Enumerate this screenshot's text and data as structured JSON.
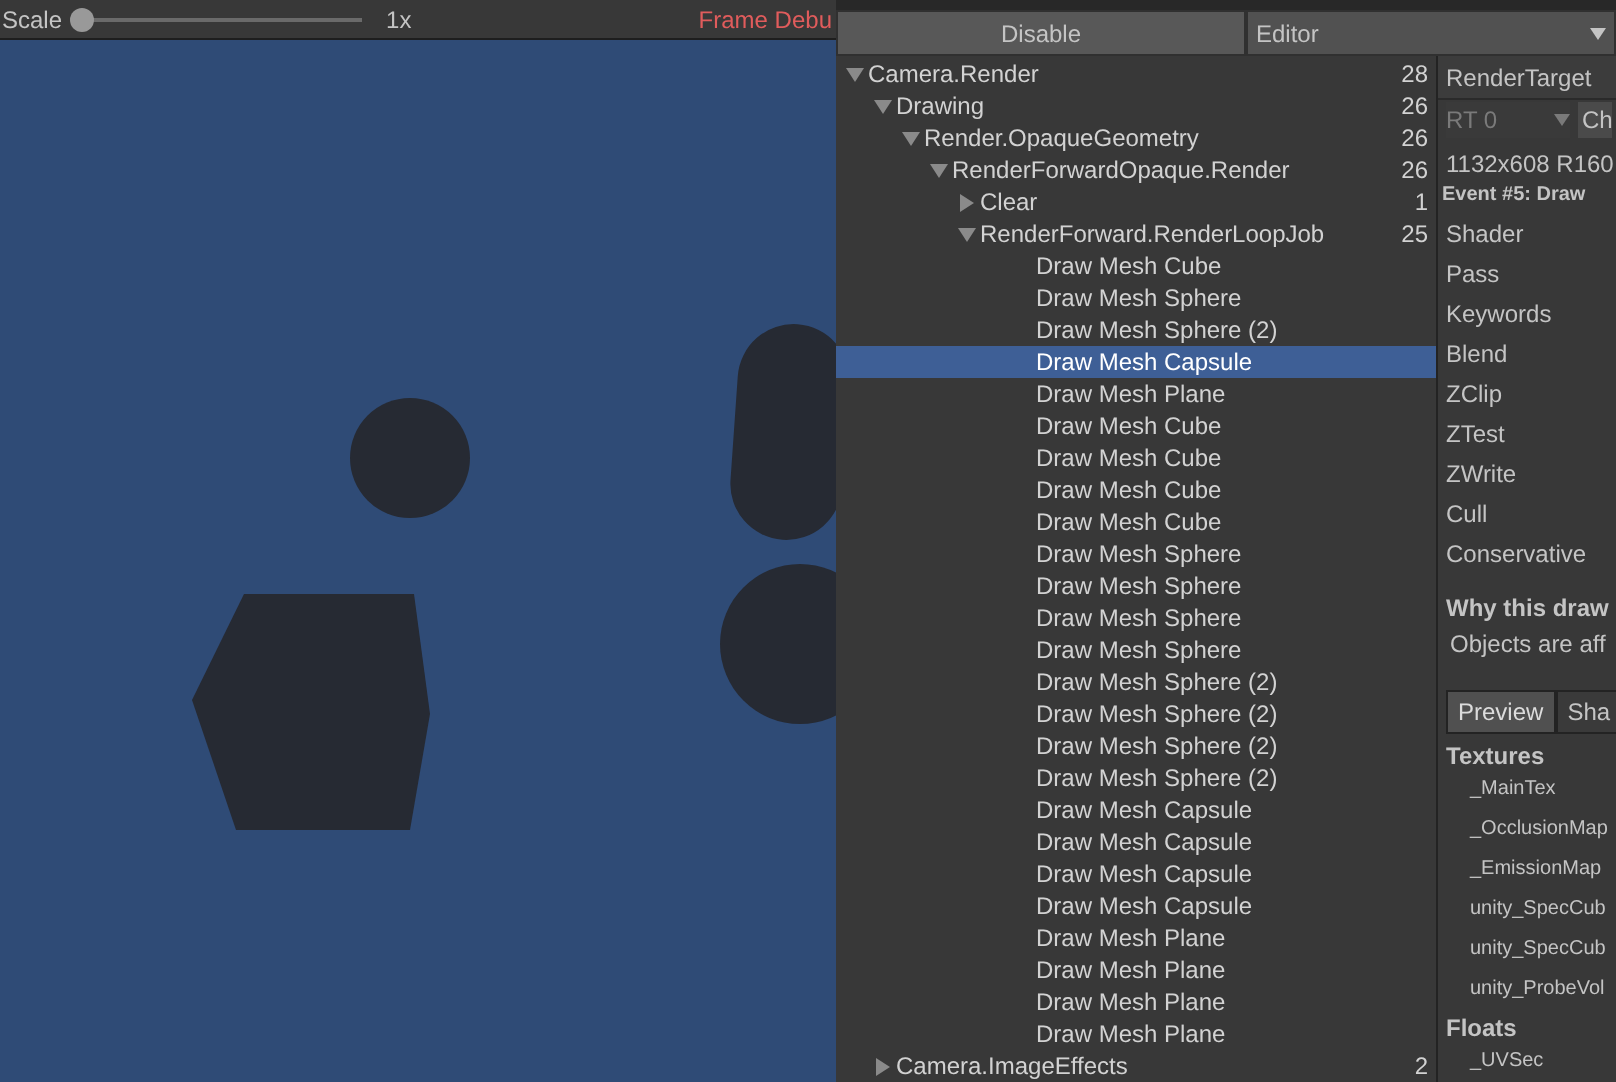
{
  "game_view": {
    "scale_label": "Scale",
    "scale_slider": {
      "level": 0
    },
    "scale_value": "1x",
    "frame_debugger_label": "Frame Debu"
  },
  "toolbar": {
    "disable_button": "Disable",
    "target_dropdown": "Editor"
  },
  "event_tree": [
    {
      "label": "Camera.Render",
      "count": "28",
      "expanded": true,
      "selected": false,
      "children": [
        {
          "label": "Drawing",
          "count": "26",
          "expanded": true,
          "selected": false,
          "children": [
            {
              "label": "Render.OpaqueGeometry",
              "count": "26",
              "expanded": true,
              "selected": false,
              "children": [
                {
                  "label": "RenderForwardOpaque.Render",
                  "count": "26",
                  "expanded": true,
                  "selected": false,
                  "children": [
                    {
                      "label": "Clear",
                      "count": "1",
                      "expanded": false,
                      "selected": false
                    },
                    {
                      "label": "RenderForward.RenderLoopJob",
                      "count": "25",
                      "expanded": true,
                      "selected": false,
                      "children": [
                        {
                          "label": "Draw Mesh Cube",
                          "selected": false
                        },
                        {
                          "label": "Draw Mesh Sphere",
                          "selected": false
                        },
                        {
                          "label": "Draw Mesh Sphere (2)",
                          "selected": false
                        },
                        {
                          "label": "Draw Mesh Capsule",
                          "selected": true
                        },
                        {
                          "label": "Draw Mesh Plane",
                          "selected": false
                        },
                        {
                          "label": "Draw Mesh Cube",
                          "selected": false
                        },
                        {
                          "label": "Draw Mesh Cube",
                          "selected": false
                        },
                        {
                          "label": "Draw Mesh Cube",
                          "selected": false
                        },
                        {
                          "label": "Draw Mesh Cube",
                          "selected": false
                        },
                        {
                          "label": "Draw Mesh Sphere",
                          "selected": false
                        },
                        {
                          "label": "Draw Mesh Sphere",
                          "selected": false
                        },
                        {
                          "label": "Draw Mesh Sphere",
                          "selected": false
                        },
                        {
                          "label": "Draw Mesh Sphere",
                          "selected": false
                        },
                        {
                          "label": "Draw Mesh Sphere (2)",
                          "selected": false
                        },
                        {
                          "label": "Draw Mesh Sphere (2)",
                          "selected": false
                        },
                        {
                          "label": "Draw Mesh Sphere (2)",
                          "selected": false
                        },
                        {
                          "label": "Draw Mesh Sphere (2)",
                          "selected": false
                        },
                        {
                          "label": "Draw Mesh Capsule",
                          "selected": false
                        },
                        {
                          "label": "Draw Mesh Capsule",
                          "selected": false
                        },
                        {
                          "label": "Draw Mesh Capsule",
                          "selected": false
                        },
                        {
                          "label": "Draw Mesh Capsule",
                          "selected": false
                        },
                        {
                          "label": "Draw Mesh Plane",
                          "selected": false
                        },
                        {
                          "label": "Draw Mesh Plane",
                          "selected": false
                        },
                        {
                          "label": "Draw Mesh Plane",
                          "selected": false
                        },
                        {
                          "label": "Draw Mesh Plane",
                          "selected": false
                        }
                      ]
                    }
                  ]
                }
              ]
            }
          ]
        },
        {
          "label": "Camera.ImageEffects",
          "count": "2",
          "expanded": false,
          "selected": false
        }
      ]
    }
  ],
  "details": {
    "render_target_label": "RenderTarget",
    "rt_dropdown": "RT 0",
    "channel_dropdown": "Ch",
    "resolution": "1132x608 R160",
    "event_title": "Event #5: Draw",
    "properties": [
      "Shader",
      "Pass",
      "Keywords",
      "Blend",
      "ZClip",
      "ZTest",
      "ZWrite",
      "Cull",
      "Conservative"
    ],
    "why_heading": "Why this draw",
    "why_text": "Objects are aff",
    "tabs": [
      {
        "label": "Preview",
        "selected": true
      },
      {
        "label": "Sha",
        "selected": false
      }
    ],
    "textures_heading": "Textures",
    "textures": [
      "_MainTex",
      "_OcclusionMap",
      "_EmissionMap",
      "unity_SpecCub",
      "unity_SpecCub",
      "unity_ProbeVol"
    ],
    "floats_heading": "Floats",
    "floats": [
      "_UVSec"
    ]
  }
}
